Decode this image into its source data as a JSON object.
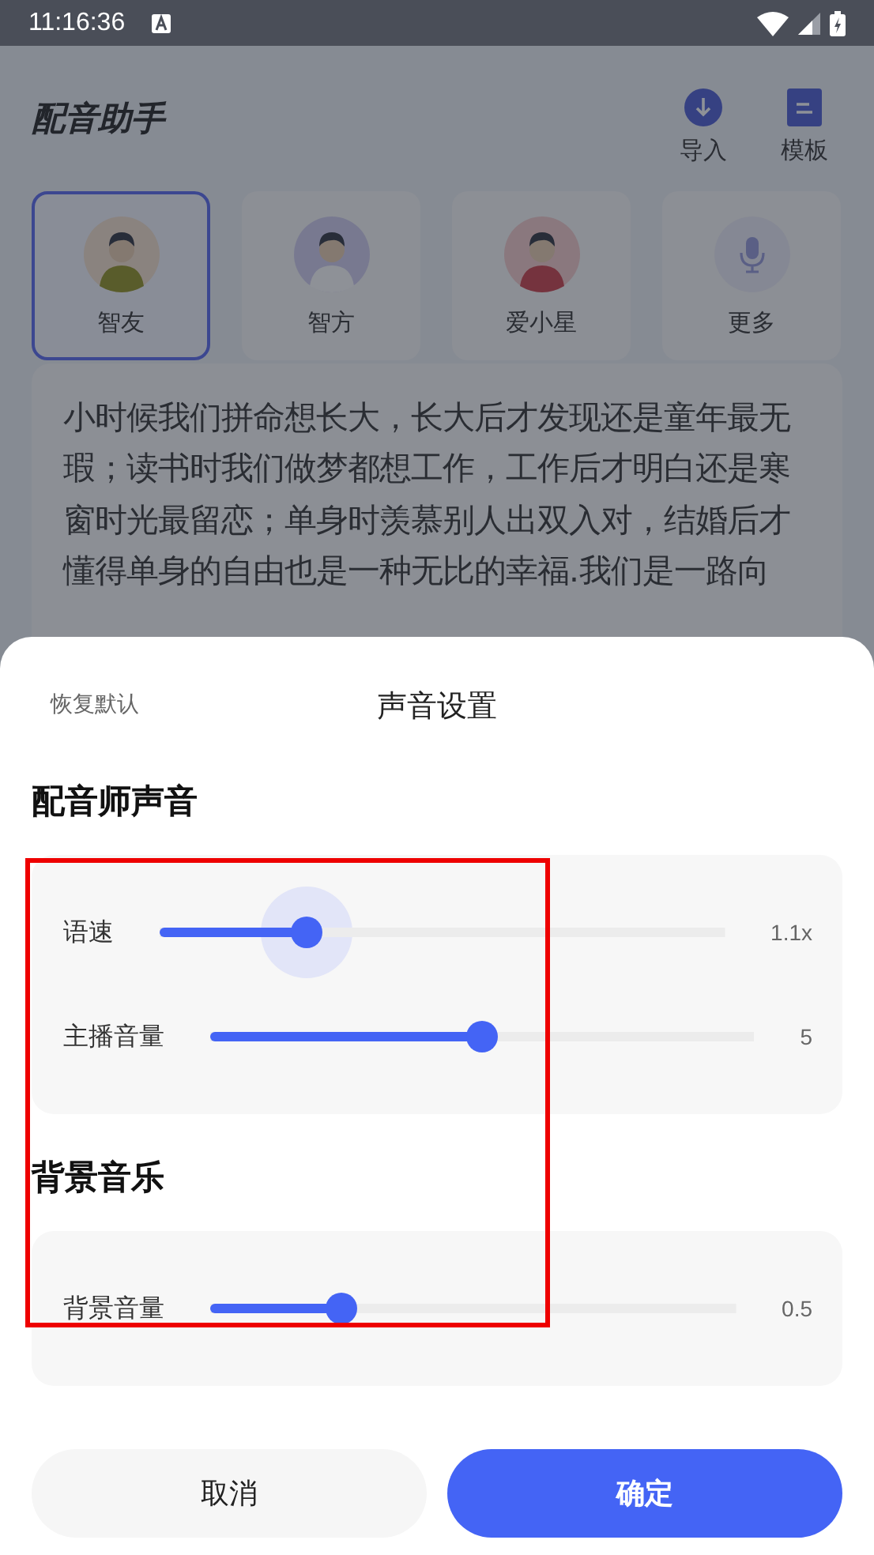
{
  "status_bar": {
    "time": "11:16:36"
  },
  "header": {
    "title": "配音助手",
    "actions": [
      {
        "label": "导入",
        "kind": "import"
      },
      {
        "label": "模板",
        "kind": "template"
      }
    ]
  },
  "voices": [
    {
      "name": "智友",
      "kind": "avatar",
      "selected": true
    },
    {
      "name": "智方",
      "kind": "avatar",
      "selected": false
    },
    {
      "name": "爱小星",
      "kind": "avatar",
      "selected": false
    },
    {
      "name": "更多",
      "kind": "more",
      "selected": false
    }
  ],
  "script": {
    "text": "小时候我们拼命想长大，长大后才发现还是童年最无瑕；读书时我们做梦都想工作，工作后才明白还是寒窗时光最留恋；单身时羡慕别人出双入对，结婚后才懂得单身的自由也是一种无比的幸福.我们是一路向"
  },
  "sheet": {
    "reset": "恢复默认",
    "title": "声音设置",
    "sections": [
      {
        "title": "配音师声音",
        "sliders": [
          {
            "label": "语速",
            "level": 0.26,
            "reading": "1.1x",
            "pressed": true
          },
          {
            "label": "主播音量",
            "level": 0.5,
            "reading": "5",
            "pressed": false
          }
        ]
      },
      {
        "title": "背景音乐",
        "sliders": [
          {
            "label": "背景音量",
            "level": 0.25,
            "reading": "0.5",
            "pressed": false
          }
        ]
      }
    ],
    "buttons": [
      {
        "label": "取消",
        "kind": "secondary"
      },
      {
        "label": "确定",
        "kind": "primary"
      }
    ]
  }
}
